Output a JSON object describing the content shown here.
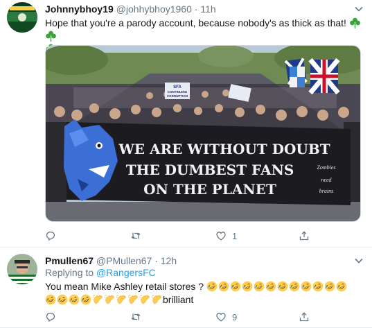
{
  "tweet1": {
    "name": "Johnnybhoy19",
    "handle": "@johhybhoy1960",
    "separator": "·",
    "time": "11h",
    "text": "Hope that you're a parody account, because nobody's as thick as that!",
    "trailing_icons": [
      "shamrock-icon",
      "shamrock-icon",
      "shamrock-icon"
    ],
    "banner": {
      "line1": "WE ARE WITHOUT DOUBT",
      "line2": "THE DUMBEST FANS",
      "line3": "ON THE PLANET",
      "side1": "Zombies",
      "side2": "need",
      "side3": "brains"
    },
    "signs": {
      "sign1": "SFA",
      "sign2": "CONTINUING",
      "sign3": "CORRUPTION"
    },
    "actions": {
      "reply_count": "",
      "retweet_count": "",
      "like_count": "1"
    }
  },
  "tweet2": {
    "name": "Pmullen67",
    "handle": "@PMullen67",
    "separator": "·",
    "time": "12h",
    "replying_prefix": "Replying to",
    "replying_to": "@RangersFC",
    "text": "You mean Mike Ashley retail stores ?",
    "trailing_word": "brilliant",
    "emoji_sequence": {
      "line1": [
        "rofl-emoji",
        "rofl-emoji",
        "rofl-emoji",
        "rofl-emoji",
        "rofl-emoji",
        "rofl-emoji",
        "rofl-emoji",
        "rofl-emoji",
        "rofl-emoji",
        "rofl-emoji",
        "rofl-emoji",
        "rofl-emoji"
      ],
      "line2": [
        "rofl-emoji",
        "rofl-emoji",
        "rofl-emoji",
        "rofl-emoji",
        "clap-emoji",
        "clap-emoji",
        "clap-emoji",
        "clap-emoji",
        "clap-emoji",
        "clap-emoji"
      ]
    },
    "actions": {
      "reply_count": "",
      "retweet_count": "",
      "like_count": "9"
    }
  },
  "colors": {
    "text": "#14171a",
    "muted": "#657786",
    "link": "#1da1f2",
    "divider": "#e6ecf0",
    "shamrock": "#3aa33a",
    "emoji_face": "#ffcc4d"
  }
}
